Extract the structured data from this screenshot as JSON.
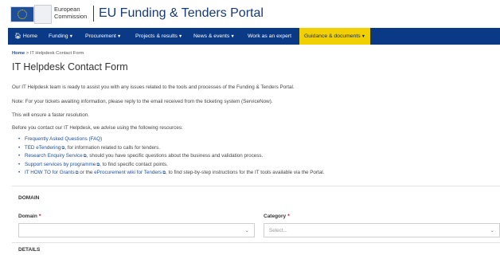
{
  "header": {
    "org_line1": "European",
    "org_line2": "Commission",
    "portal_title": "EU Funding & Tenders Portal"
  },
  "nav": {
    "items": [
      {
        "label": "Home",
        "has_caret": false
      },
      {
        "label": "Funding",
        "has_caret": true
      },
      {
        "label": "Procurement",
        "has_caret": true
      },
      {
        "label": "Projects & results",
        "has_caret": true
      },
      {
        "label": "News & events",
        "has_caret": true
      },
      {
        "label": "Work as an expert",
        "has_caret": false
      },
      {
        "label": "Guidance & documents",
        "has_caret": true,
        "active": true
      }
    ],
    "caret": "▼"
  },
  "breadcrumb": {
    "home": "Home",
    "separator": ">",
    "current": "IT Helpdesk Contact Form"
  },
  "page_title": "IT Helpdesk Contact Form",
  "intro": {
    "p1": "Our IT Helpdesk team is ready to assist you with any issues related to the tools and processes of the Funding & Tenders Portal.",
    "p2": "Note: For your tickets awaiting information, please reply to the email received from the ticketing system (ServiceNow).",
    "p3": "This will ensure a faster resolution.",
    "p4": "Before you contact our IT Helpdesk, we advise using the following resources:"
  },
  "resources": {
    "faq_link": "Frequently Asked Questions (FAQ)",
    "ted_link": "TED eTendering",
    "ted_text": ", for information related to calls for tenders.",
    "research_link": "Research Enquiry Service",
    "research_text": ", should you have specific questions about the business and validation process.",
    "support_link": "Support services by programme",
    "support_text": ", to find specific contact points.",
    "howto_link": "IT HOW TO for Grants",
    "howto_mid": " or the ",
    "wiki_link": "eProcurement wiki for Tenders",
    "howto_text": ", to find step-by-step instructions for the IT tools available via the Portal.",
    "ext_glyph": "⧉"
  },
  "form": {
    "domain_section": "DOMAIN",
    "details_section": "DETAILS",
    "domain_label": "Domain",
    "domain_value": "",
    "category_label": "Category",
    "category_placeholder": "Select...",
    "required_mark": "*",
    "chevron": "⌄"
  },
  "colors": {
    "nav_bg": "#0a3a86",
    "nav_active_bg": "#f2d000",
    "link": "#1f4e9b",
    "required": "#d0021b"
  },
  "icons": [
    "ec-flag-logo",
    "home-icon",
    "external-link-icon",
    "chevron-down-icon"
  ]
}
